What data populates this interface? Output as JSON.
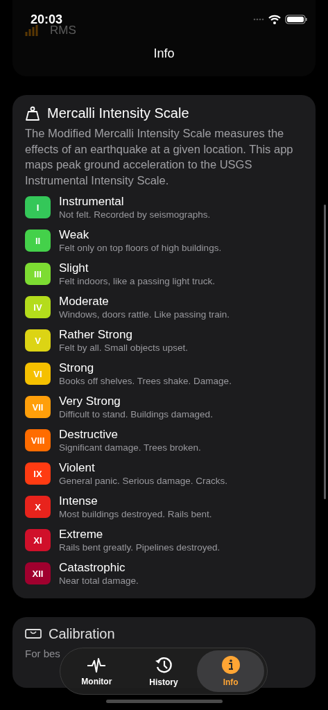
{
  "status_bar": {
    "time": "20:03"
  },
  "nav": {
    "title": "Info"
  },
  "top_card": {
    "items": [
      {
        "title": "RMS"
      }
    ]
  },
  "mercalli": {
    "title": "Mercalli Intensity Scale",
    "description": "The Modified Mercalli Intensity Scale measures the effects of an earthquake at a given location. This app maps peak ground acceleration to the USGS Instrumental Intensity Scale.",
    "levels": [
      {
        "numeral": "I",
        "name": "Instrumental",
        "description": "Not felt. Recorded by seismographs.",
        "color": "#34c759"
      },
      {
        "numeral": "II",
        "name": "Weak",
        "description": "Felt only on top floors of high buildings.",
        "color": "#44d14a"
      },
      {
        "numeral": "III",
        "name": "Slight",
        "description": "Felt indoors, like a passing light truck.",
        "color": "#7ddc32"
      },
      {
        "numeral": "IV",
        "name": "Moderate",
        "description": "Windows, doors rattle. Like passing train.",
        "color": "#b4dc1c"
      },
      {
        "numeral": "V",
        "name": "Rather Strong",
        "description": "Felt by all. Small objects upset.",
        "color": "#dcd414"
      },
      {
        "numeral": "VI",
        "name": "Strong",
        "description": "Books off shelves. Trees shake. Damage.",
        "color": "#f5c000"
      },
      {
        "numeral": "VII",
        "name": "Very Strong",
        "description": "Difficult to stand. Buildings damaged.",
        "color": "#ff9f0a"
      },
      {
        "numeral": "VIII",
        "name": "Destructive",
        "description": "Significant damage. Trees broken.",
        "color": "#ff6c00"
      },
      {
        "numeral": "IX",
        "name": "Violent",
        "description": "General panic. Serious damage. Cracks.",
        "color": "#ff3b12"
      },
      {
        "numeral": "X",
        "name": "Intense",
        "description": "Most buildings destroyed. Rails bent.",
        "color": "#e8231c"
      },
      {
        "numeral": "XI",
        "name": "Extreme",
        "description": "Rails bent greatly. Pipelines destroyed.",
        "color": "#d0102a"
      },
      {
        "numeral": "XII",
        "name": "Catastrophic",
        "description": "Near total damage.",
        "color": "#a0002e"
      }
    ]
  },
  "calibration": {
    "title": "Calibration",
    "intro": "For bes"
  },
  "tab_bar": {
    "tabs": [
      {
        "label": "Monitor",
        "kind": "monitor",
        "selected": false
      },
      {
        "label": "History",
        "kind": "history",
        "selected": false
      },
      {
        "label": "Info",
        "kind": "info",
        "selected": true
      }
    ]
  }
}
